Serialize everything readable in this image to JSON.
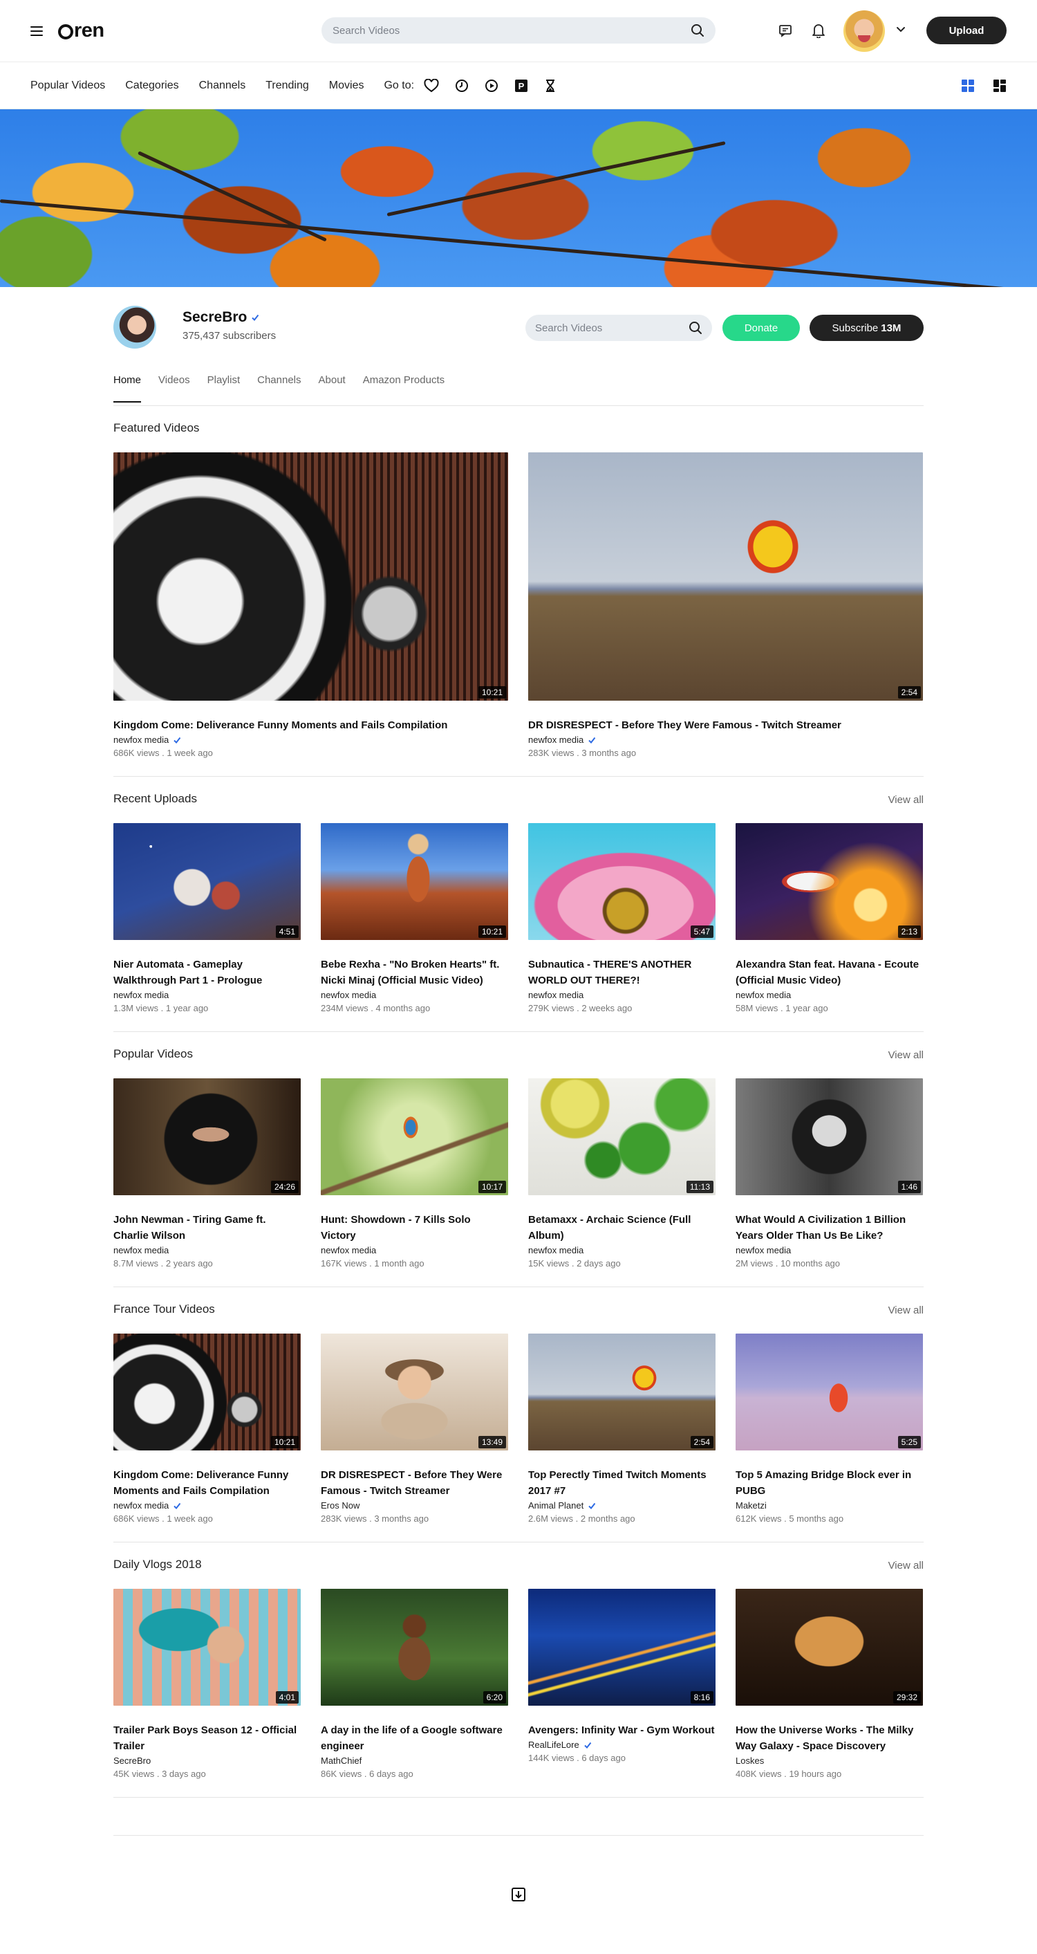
{
  "header": {
    "logo": "ren",
    "search_placeholder": "Search Videos",
    "upload_label": "Upload",
    "icons": [
      "menu-icon",
      "search-icon",
      "chat-icon",
      "bell-icon",
      "chevron-down-icon"
    ]
  },
  "nav": {
    "items": [
      "Popular Videos",
      "Categories",
      "Channels",
      "Trending",
      "Movies"
    ],
    "goto_label": "Go to:",
    "goto_icons": [
      "heart-icon",
      "clock-icon",
      "play-icon",
      "p-badge-icon",
      "hourglass-icon"
    ],
    "view_icons": [
      "grid-view-icon",
      "masonry-view-icon"
    ]
  },
  "channel": {
    "name": "SecreBro",
    "subscribers": "375,437 subscribers",
    "search_placeholder": "Search Videos",
    "donate_label": "Donate",
    "subscribe_label": "Subscribe",
    "subscribe_count": "13M",
    "tabs": [
      "Home",
      "Videos",
      "Playlist",
      "Channels",
      "About",
      "Amazon Products"
    ],
    "active_tab": "Home"
  },
  "featured": {
    "title": "Featured Videos",
    "videos": [
      {
        "title": "Kingdom Come: Deliverance Funny Moments and Fails Compilation",
        "channel": "newfox media",
        "verified": true,
        "meta": "686K views . 1 week ago",
        "duration": "10:21",
        "thumb": "car"
      },
      {
        "title": "DR DISRESPECT - Before They Were Famous - Twitch Streamer",
        "channel": "newfox media",
        "verified": true,
        "meta": "283K views . 3 months ago",
        "duration": "2:54",
        "thumb": "balloon"
      }
    ]
  },
  "sections": [
    {
      "title": "Recent Uploads",
      "view_all": "View all",
      "videos": [
        {
          "title": "Nier Automata - Gameplay Walkthrough Part 1 - Prologue",
          "channel": "newfox media",
          "verified": false,
          "meta": "1.3M views . 1 year ago",
          "duration": "4:51",
          "thumb": "snow"
        },
        {
          "title": "Bebe Rexha - \"No Broken Hearts\" ft. Nicki Minaj (Official Music Video)",
          "channel": "newfox media",
          "verified": false,
          "meta": "234M views . 4 months ago",
          "duration": "10:21",
          "thumb": "woman-road"
        },
        {
          "title": "Subnautica - THERE'S ANOTHER WORLD OUT THERE?!",
          "channel": "newfox media",
          "verified": false,
          "meta": "279K views . 2 weeks ago",
          "duration": "5:47",
          "thumb": "flower"
        },
        {
          "title": "Alexandra Stan feat. Havana - Ecoute (Official Music Video)",
          "channel": "newfox media",
          "verified": false,
          "meta": "58M views . 1 year ago",
          "duration": "2:13",
          "thumb": "soccer"
        }
      ]
    },
    {
      "title": "Popular Videos",
      "view_all": "View all",
      "videos": [
        {
          "title": "John Newman - Tiring Game ft. Charlie Wilson",
          "channel": "newfox media",
          "verified": false,
          "meta": "8.7M views . 2 years ago",
          "duration": "24:26",
          "thumb": "hijab"
        },
        {
          "title": "Hunt: Showdown - 7 Kills Solo Victory",
          "channel": "newfox media",
          "verified": false,
          "meta": "167K views . 1 month ago",
          "duration": "10:17",
          "thumb": "bird"
        },
        {
          "title": "Betamaxx - Archaic Science (Full Album)",
          "channel": "newfox media",
          "verified": false,
          "meta": "15K views . 2 days ago",
          "duration": "11:13",
          "thumb": "herbs"
        },
        {
          "title": "What Would A Civilization 1 Billion Years Older Than Us Be Like?",
          "channel": "newfox media",
          "verified": false,
          "meta": "2M views . 10 months ago",
          "duration": "1:46",
          "thumb": "bw-portrait"
        }
      ]
    },
    {
      "title": "France Tour Videos",
      "view_all": "View all",
      "videos": [
        {
          "title": "Kingdom Come: Deliverance Funny Moments and Fails Compilation",
          "channel": "newfox media",
          "verified": true,
          "meta": "686K views . 1 week ago",
          "duration": "10:21",
          "thumb": "car"
        },
        {
          "title": "DR DISRESPECT - Before They Were Famous - Twitch Streamer",
          "channel": "Eros Now",
          "verified": false,
          "meta": "283K views . 3 months ago",
          "duration": "13:49",
          "thumb": "baby"
        },
        {
          "title": "Top Perectly Timed Twitch Moments 2017 #7",
          "channel": "Animal Planet",
          "verified": true,
          "meta": "2.6M views . 2 months ago",
          "duration": "2:54",
          "thumb": "balloon"
        },
        {
          "title": "Top 5 Amazing Bridge Block ever in PUBG",
          "channel": "Maketzi",
          "verified": false,
          "meta": "612K views . 5 months ago",
          "duration": "5:25",
          "thumb": "dancer"
        }
      ]
    },
    {
      "title": "Daily Vlogs 2018",
      "view_all": "View all",
      "videos": [
        {
          "title": "Trailer Park Boys Season 12 - Official Trailer",
          "channel": "SecreBro",
          "verified": false,
          "meta": "45K views . 3 days ago",
          "duration": "4:01",
          "thumb": "teal-hair"
        },
        {
          "title": "A day in the life of a Google software engineer",
          "channel": "MathChief",
          "verified": false,
          "meta": "86K views . 6 days ago",
          "duration": "6:20",
          "thumb": "forest-kid"
        },
        {
          "title": "Avengers: Infinity War - Gym Workout",
          "channel": "RealLifeLore",
          "verified": true,
          "meta": "144K views . 6 days ago",
          "duration": "8:16",
          "thumb": "city-night"
        },
        {
          "title": "How the Universe Works - The Milky Way Galaxy - Space Discovery",
          "channel": "Loskes",
          "verified": false,
          "meta": "408K views . 19 hours ago",
          "duration": "29:32",
          "thumb": "cat"
        }
      ]
    }
  ],
  "colors": {
    "accent_green": "#27d88a",
    "dark_button": "#222222",
    "verified_blue": "#2d6ae3",
    "view_toggle_active": "#2d6ae3"
  }
}
